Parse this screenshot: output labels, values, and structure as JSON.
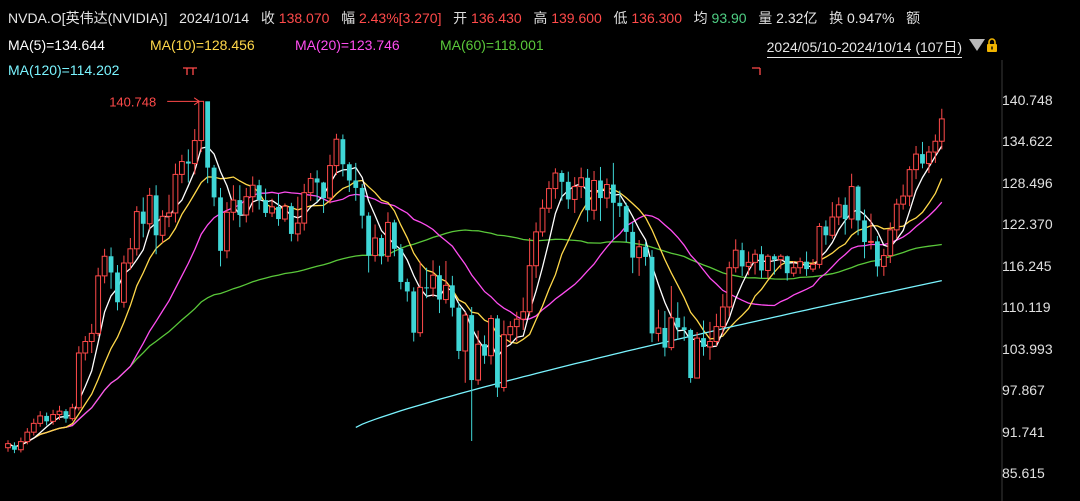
{
  "header": {
    "symbol": "NVDA.O[英伟达(NVIDIA)]",
    "date": "2024/10/14",
    "close_label": "收",
    "close_value": "138.070",
    "change_label": "幅",
    "change_value": "2.43%[3.270]",
    "open_label": "开",
    "open_value": "136.430",
    "high_label": "高",
    "high_value": "139.600",
    "low_label": "低",
    "low_value": "136.300",
    "avg_label": "均",
    "avg_value": "93.90",
    "volume_label": "量",
    "volume_value": "2.32亿",
    "turnover_label": "换",
    "turnover_value": "0.947%",
    "overflow_char": "额"
  },
  "indicators": {
    "ma5": "MA(5)=134.644",
    "ma10": "MA(10)=128.456",
    "ma20": "MA(20)=123.746",
    "ma60": "MA(60)=118.001",
    "ma120": "MA(120)=114.202"
  },
  "range": {
    "label": "2024/05/10-2024/10/14 (107日)",
    "dropdown_icon": "triangle-down-icon",
    "lock_icon": "lock-icon"
  },
  "max_marker": "140.748",
  "colors": {
    "up": "#ff4a4a",
    "down": "#3fd6d6",
    "ma5": "#ffffff",
    "ma10": "#ffd84a",
    "ma20": "#ff4df0",
    "ma60": "#5ac83a",
    "ma120": "#7af4ff"
  },
  "axis": {
    "ticks": [
      "140.748",
      "134.622",
      "128.496",
      "122.370",
      "116.245",
      "110.119",
      "103.993",
      "97.867",
      "91.741",
      "85.615"
    ]
  },
  "chart_data": {
    "type": "candlestick",
    "x_range": [
      "2024/05/10",
      "2024/10/14"
    ],
    "ylim": [
      85.615,
      140.748
    ],
    "candles": [
      [
        89.5,
        90.1,
        88.9,
        90.6
      ],
      [
        89.8,
        89.2,
        88.7,
        90.3
      ],
      [
        89.2,
        90.4,
        88.8,
        91.0
      ],
      [
        90.4,
        91.8,
        90.0,
        92.4
      ],
      [
        91.8,
        93.1,
        91.3,
        93.8
      ],
      [
        93.1,
        94.2,
        92.6,
        94.9
      ],
      [
        94.2,
        93.4,
        92.8,
        94.7
      ],
      [
        93.4,
        94.4,
        92.9,
        95.1
      ],
      [
        94.4,
        94.9,
        93.6,
        95.7
      ],
      [
        94.9,
        93.8,
        93.2,
        95.2
      ],
      [
        93.8,
        95.4,
        93.5,
        96.0
      ],
      [
        95.4,
        103.5,
        95.0,
        104.5
      ],
      [
        103.5,
        105.2,
        102.4,
        106.0
      ],
      [
        105.2,
        106.4,
        103.5,
        107.8
      ],
      [
        106.4,
        114.9,
        106.0,
        116.1
      ],
      [
        114.9,
        117.8,
        113.8,
        118.9
      ],
      [
        117.8,
        115.4,
        113.0,
        119.1
      ],
      [
        115.4,
        111.0,
        109.8,
        116.5
      ],
      [
        111.0,
        116.8,
        110.2,
        117.9
      ],
      [
        116.8,
        118.9,
        115.8,
        120.5
      ],
      [
        118.9,
        124.4,
        117.9,
        125.2
      ],
      [
        124.4,
        122.6,
        120.6,
        126.5
      ],
      [
        122.6,
        126.8,
        121.7,
        127.9
      ],
      [
        126.8,
        120.9,
        118.1,
        128.3
      ],
      [
        120.9,
        123.7,
        119.8,
        124.6
      ],
      [
        123.7,
        124.2,
        122.1,
        126.9
      ],
      [
        124.2,
        129.9,
        122.8,
        131.5
      ],
      [
        129.9,
        131.8,
        128.6,
        132.8
      ],
      [
        131.8,
        131.5,
        128.7,
        133.6
      ],
      [
        131.5,
        134.9,
        129.9,
        136.6
      ],
      [
        134.9,
        140.7,
        133.2,
        140.7
      ],
      [
        140.7,
        130.9,
        128.6,
        140.2
      ],
      [
        130.9,
        126.5,
        125.2,
        131.3
      ],
      [
        126.5,
        118.6,
        116.3,
        127.9
      ],
      [
        118.6,
        124.3,
        117.5,
        125.8
      ],
      [
        124.3,
        126.1,
        123.1,
        128.3
      ],
      [
        126.1,
        123.9,
        122.1,
        128.3
      ],
      [
        123.9,
        126.6,
        122.8,
        127.9
      ],
      [
        126.6,
        128.3,
        124.3,
        129.6
      ],
      [
        128.3,
        126.1,
        124.7,
        129.1
      ],
      [
        126.1,
        124.2,
        123.6,
        127.8
      ],
      [
        124.2,
        125.1,
        123.6,
        126.3
      ],
      [
        125.1,
        123.3,
        122.3,
        127.0
      ],
      [
        123.3,
        125.2,
        122.9,
        125.6
      ],
      [
        125.2,
        121.1,
        120.0,
        125.7
      ],
      [
        121.1,
        122.7,
        120.0,
        126.6
      ],
      [
        122.7,
        127.2,
        121.6,
        128.5
      ],
      [
        127.2,
        129.3,
        126.0,
        130.1
      ],
      [
        129.3,
        128.7,
        125.9,
        130.5
      ],
      [
        128.7,
        126.4,
        124.2,
        128.8
      ],
      [
        126.4,
        131.2,
        125.6,
        132.8
      ],
      [
        131.2,
        135.1,
        129.8,
        135.9
      ],
      [
        135.1,
        131.4,
        129.6,
        135.8
      ],
      [
        131.4,
        129.0,
        127.3,
        131.7
      ],
      [
        129.0,
        127.9,
        126.0,
        131.6
      ],
      [
        127.9,
        123.8,
        121.9,
        128.5
      ],
      [
        123.8,
        117.9,
        115.4,
        124.3
      ],
      [
        117.9,
        120.5,
        117.0,
        122.5
      ],
      [
        120.5,
        117.8,
        116.6,
        121.0
      ],
      [
        117.8,
        122.8,
        117.0,
        124.3
      ],
      [
        122.8,
        118.9,
        117.8,
        123.2
      ],
      [
        118.9,
        114.0,
        112.9,
        119.6
      ],
      [
        114.0,
        112.6,
        111.1,
        114.5
      ],
      [
        112.6,
        106.5,
        105.2,
        113.2
      ],
      [
        106.5,
        113.2,
        105.9,
        117.0
      ],
      [
        113.2,
        113.1,
        111.6,
        116.1
      ],
      [
        113.1,
        115.0,
        111.8,
        117.2
      ],
      [
        115.0,
        111.4,
        109.4,
        116.4
      ],
      [
        111.4,
        113.5,
        110.8,
        117.1
      ],
      [
        113.5,
        110.2,
        108.9,
        114.9
      ],
      [
        110.2,
        103.8,
        102.6,
        110.9
      ],
      [
        103.8,
        109.1,
        99.1,
        109.6
      ],
      [
        109.1,
        99.5,
        90.5,
        110.3
      ],
      [
        99.5,
        104.8,
        98.8,
        106.8
      ],
      [
        104.8,
        103.1,
        101.9,
        106.1
      ],
      [
        103.1,
        108.6,
        101.8,
        109.1
      ],
      [
        108.6,
        98.4,
        97.0,
        109.1
      ],
      [
        98.4,
        106.2,
        97.8,
        108.3
      ],
      [
        106.2,
        107.4,
        105.1,
        108.2
      ],
      [
        107.4,
        108.5,
        105.2,
        109.6
      ],
      [
        108.5,
        109.6,
        106.9,
        111.7
      ],
      [
        109.6,
        116.4,
        109.0,
        120.5
      ],
      [
        116.4,
        121.4,
        114.6,
        122.8
      ],
      [
        121.4,
        124.9,
        120.7,
        126.2
      ],
      [
        124.9,
        127.8,
        124.2,
        128.9
      ],
      [
        127.8,
        130.1,
        126.3,
        130.8
      ],
      [
        130.1,
        128.8,
        126.0,
        130.5
      ],
      [
        128.8,
        126.2,
        124.8,
        130.3
      ],
      [
        126.2,
        128.1,
        124.2,
        129.5
      ],
      [
        128.1,
        129.4,
        126.4,
        130.9
      ],
      [
        129.4,
        124.6,
        122.9,
        130.7
      ],
      [
        124.6,
        129.0,
        123.2,
        130.4
      ],
      [
        129.0,
        126.4,
        123.0,
        131.0
      ],
      [
        126.4,
        128.4,
        124.9,
        129.3
      ],
      [
        128.4,
        125.7,
        120.2,
        131.6
      ],
      [
        125.7,
        125.2,
        123.6,
        127.5
      ],
      [
        125.2,
        121.4,
        119.9,
        125.7
      ],
      [
        121.4,
        117.6,
        115.3,
        122.8
      ],
      [
        117.6,
        119.2,
        114.9,
        120.2
      ],
      [
        119.2,
        117.7,
        116.4,
        119.9
      ],
      [
        117.7,
        106.4,
        105.1,
        118.7
      ],
      [
        106.4,
        107.2,
        105.2,
        109.9
      ],
      [
        107.2,
        104.3,
        103.0,
        109.7
      ],
      [
        104.3,
        108.7,
        103.9,
        113.4
      ],
      [
        108.7,
        107.3,
        105.5,
        111.0
      ],
      [
        107.3,
        106.9,
        105.3,
        108.9
      ],
      [
        106.9,
        99.8,
        99.1,
        107.1
      ],
      [
        99.8,
        105.7,
        103.3,
        106.6
      ],
      [
        105.7,
        104.4,
        103.1,
        108.3
      ],
      [
        104.4,
        105.2,
        102.5,
        108.1
      ],
      [
        105.2,
        107.4,
        104.5,
        109.3
      ],
      [
        107.4,
        110.3,
        106.2,
        112.2
      ],
      [
        110.3,
        116.1,
        108.9,
        117.0
      ],
      [
        116.1,
        118.7,
        115.4,
        120.3
      ],
      [
        118.7,
        116.3,
        114.9,
        119.8
      ],
      [
        116.3,
        116.9,
        115.0,
        118.5
      ],
      [
        116.9,
        118.1,
        115.1,
        118.8
      ],
      [
        118.1,
        115.7,
        114.6,
        119.3
      ],
      [
        115.7,
        117.8,
        114.5,
        118.1
      ],
      [
        117.8,
        117.3,
        115.1,
        118.1
      ],
      [
        117.3,
        117.8,
        115.9,
        118.1
      ],
      [
        117.8,
        115.3,
        114.2,
        117.9
      ],
      [
        115.3,
        116.1,
        114.8,
        117.1
      ],
      [
        116.1,
        117.0,
        115.2,
        117.6
      ],
      [
        117.0,
        115.9,
        114.9,
        118.5
      ],
      [
        115.9,
        116.6,
        115.5,
        117.4
      ],
      [
        116.6,
        122.2,
        116.0,
        122.7
      ],
      [
        122.2,
        120.9,
        119.5,
        123.1
      ],
      [
        120.9,
        123.6,
        120.4,
        125.8
      ],
      [
        123.6,
        125.4,
        122.4,
        126.5
      ],
      [
        125.4,
        123.3,
        121.0,
        126.5
      ],
      [
        123.3,
        128.1,
        121.9,
        130.0
      ],
      [
        128.1,
        123.1,
        120.9,
        128.3
      ],
      [
        123.1,
        119.9,
        117.5,
        124.7
      ],
      [
        119.9,
        120.0,
        118.8,
        124.1
      ],
      [
        120.0,
        116.3,
        114.8,
        120.8
      ],
      [
        116.3,
        117.9,
        114.9,
        118.9
      ],
      [
        117.9,
        121.7,
        116.8,
        122.8
      ],
      [
        121.7,
        125.5,
        120.4,
        126.3
      ],
      [
        125.5,
        126.7,
        124.7,
        128.4
      ],
      [
        126.7,
        130.6,
        125.2,
        131.1
      ],
      [
        130.6,
        132.9,
        129.2,
        134.1
      ],
      [
        132.9,
        131.5,
        130.8,
        134.7
      ],
      [
        131.5,
        133.2,
        130.1,
        134.1
      ],
      [
        133.2,
        134.8,
        131.6,
        135.8
      ],
      [
        134.8,
        138.1,
        133.6,
        139.6
      ]
    ],
    "series": [
      {
        "name": "MA(5)",
        "end_value": 134.644
      },
      {
        "name": "MA(10)",
        "end_value": 128.456
      },
      {
        "name": "MA(20)",
        "end_value": 123.746
      },
      {
        "name": "MA(60)",
        "end_value": 118.001
      },
      {
        "name": "MA(120)",
        "end_value": 114.202
      }
    ]
  }
}
